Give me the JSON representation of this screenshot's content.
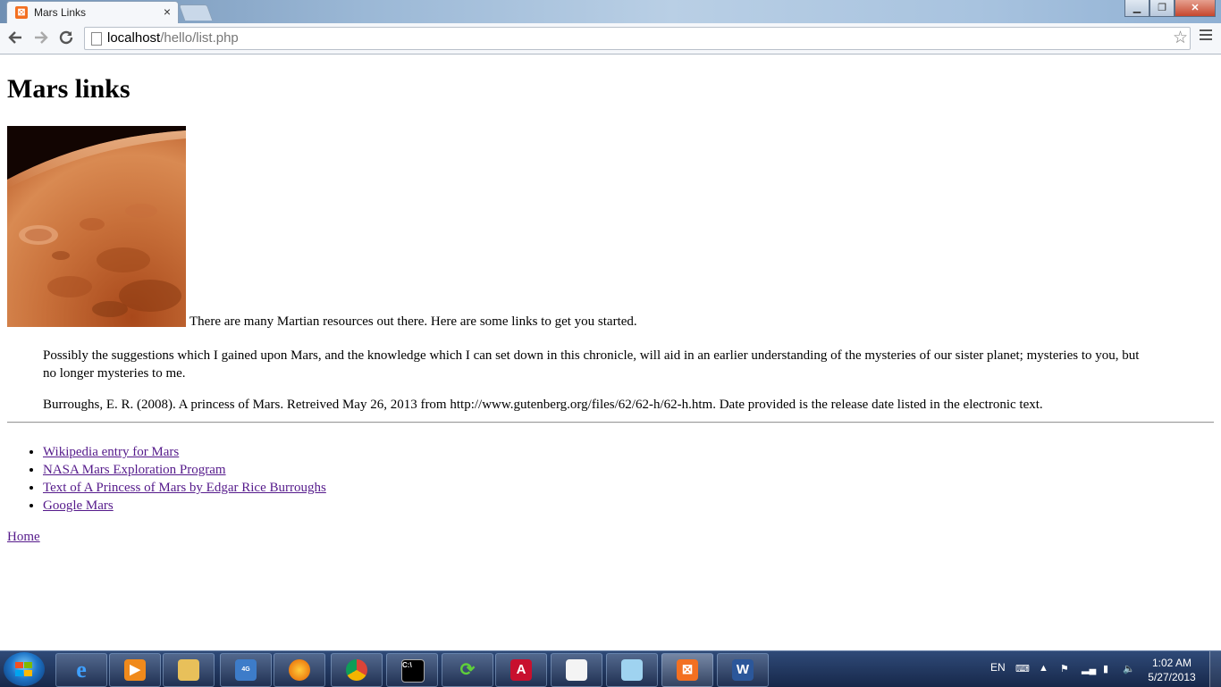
{
  "browser": {
    "tab_title": "Mars Links",
    "url_host": "localhost",
    "url_path": "/hello/list.php"
  },
  "page": {
    "heading": "Mars links",
    "intro": "There are many Martian resources out there. Here are some links to get you started.",
    "quote": "Possibly the suggestions which I gained upon Mars, and the knowledge which I can set down in this chronicle, will aid in an earlier understanding of the mysteries of our sister planet; mysteries to you, but no longer mysteries to me.",
    "citation": "Burroughs, E. R. (2008). A princess of Mars. Retreived May 26, 2013 from http://www.gutenberg.org/files/62/62-h/62-h.htm. Date provided is the release date listed in the electronic text.",
    "links": [
      "Wikipedia entry for Mars",
      "NASA Mars Exploration Program",
      "Text of A Princess of Mars by Edgar Rice Burroughs",
      "Google Mars"
    ],
    "home_link": "Home",
    "link_color": "#551a8b"
  },
  "taskbar": {
    "apps": [
      "internet-explorer-icon",
      "media-player-icon",
      "file-explorer-icon",
      "wimax-icon",
      "firefox-icon",
      "chrome-icon",
      "command-prompt-icon",
      "sync-icon",
      "acrobat-icon",
      "document-icon",
      "notepad-icon",
      "xampp-icon",
      "word-icon"
    ],
    "language": "EN",
    "time": "1:02 AM",
    "date": "5/27/2013"
  }
}
